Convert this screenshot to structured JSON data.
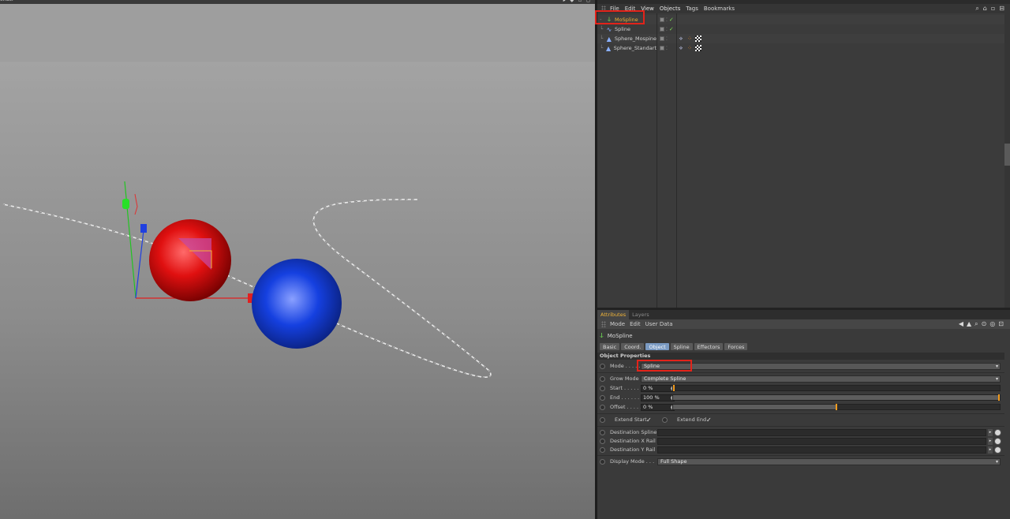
{
  "viewport": {
    "label": "ender",
    "icons": "▸ ◆ ▫ ◻"
  },
  "object_manager": {
    "menu": [
      "File",
      "Edit",
      "View",
      "Objects",
      "Tags",
      "Bookmarks"
    ],
    "tools": [
      "search-icon",
      "home-icon",
      "fit-icon",
      "maximize-icon"
    ],
    "objects": [
      {
        "name": "MoSpline",
        "icon": "mospline-icon",
        "active": true,
        "tags": []
      },
      {
        "name": "Spline",
        "icon": "spline-icon",
        "active": false,
        "tags": []
      },
      {
        "name": "Sphere_Mospine",
        "icon": "sphere-icon",
        "active": false,
        "tags": [
          "phong-tag",
          "material-tag",
          "checker-tag"
        ]
      },
      {
        "name": "Sphere_Standart",
        "icon": "sphere-icon",
        "active": false,
        "tags": [
          "phong-tag",
          "material-tag",
          "checker-tag"
        ]
      }
    ]
  },
  "attribute_manager": {
    "tabs": [
      "Attributes",
      "Layers"
    ],
    "menu": [
      "Mode",
      "Edit",
      "User Data"
    ],
    "object_name": "MoSpline",
    "subtabs": [
      "Basic",
      "Coord.",
      "Object",
      "Spline",
      "Effectors",
      "Forces"
    ],
    "active_subtab": "Object",
    "section_title": "Object Properties",
    "mode": {
      "label": "Mode . . . . . . .",
      "value": "Spline"
    },
    "grow_mode": {
      "label": "Grow Mode",
      "value": "Complete Spline"
    },
    "start": {
      "label": "Start . . . . . . .",
      "value": "0 %",
      "fraction": 0.0
    },
    "end": {
      "label": "End . . . . . . . .",
      "value": "100 %",
      "fraction": 1.0
    },
    "offset": {
      "label": "Offset . . . . . .",
      "value": "0 %",
      "fraction": 0.5
    },
    "extend_start": {
      "label": "Extend Start",
      "checked": "✓"
    },
    "extend_end": {
      "label": "Extend End",
      "checked": "✓"
    },
    "destination_spline": {
      "label": "Destination Spline"
    },
    "destination_x_rail": {
      "label": "Destination X Rail"
    },
    "destination_y_rail": {
      "label": "Destination Y Rail"
    },
    "display_mode": {
      "label": "Display Mode . . .",
      "value": "Full Shape"
    }
  },
  "colors": {
    "highlight": "#e2231a",
    "active_text": "#f1b437",
    "sphere_red": "#e01010",
    "sphere_blue": "#1540e0"
  }
}
